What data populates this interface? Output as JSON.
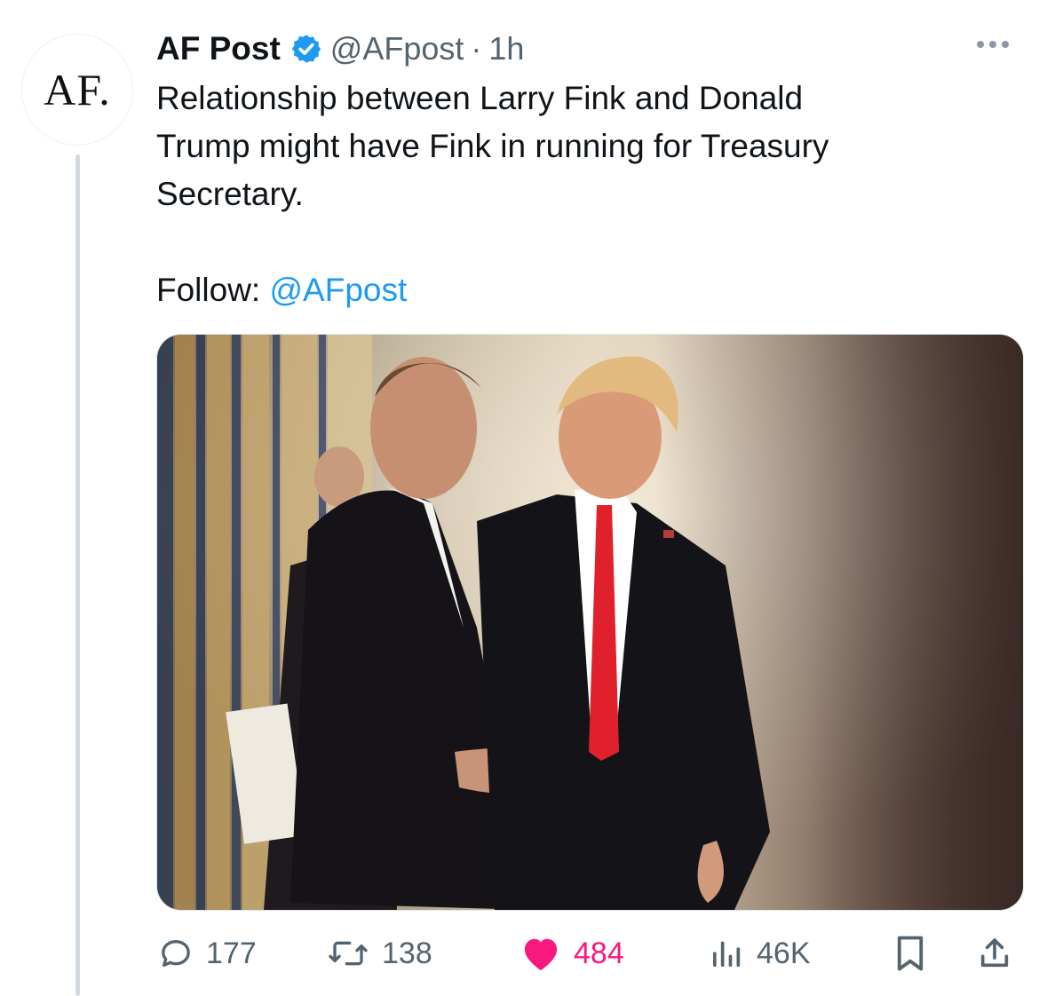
{
  "author": {
    "avatar_text": "AF.",
    "name": "AF Post",
    "handle": "@AFpost",
    "separator": "·",
    "time": "1h",
    "verified": true
  },
  "tweet": {
    "text": "Relationship between Larry Fink and Donald\nTrump might have Fink in running for Treasury\nSecretary.",
    "follow_label": "Follow: ",
    "follow_handle": "@AFpost"
  },
  "actions": {
    "reply": {
      "icon": "reply-icon",
      "count": "177"
    },
    "repost": {
      "icon": "repost-icon",
      "count": "138"
    },
    "like": {
      "icon": "heart-icon",
      "count": "484",
      "liked": true
    },
    "views": {
      "icon": "views-icon",
      "count": "46K"
    },
    "bookmark": {
      "icon": "bookmark-icon"
    },
    "share": {
      "icon": "share-icon"
    }
  },
  "colors": {
    "link": "#1d9bf0",
    "like": "#f91880",
    "muted": "#536471",
    "verified": "#1d9bf0"
  }
}
